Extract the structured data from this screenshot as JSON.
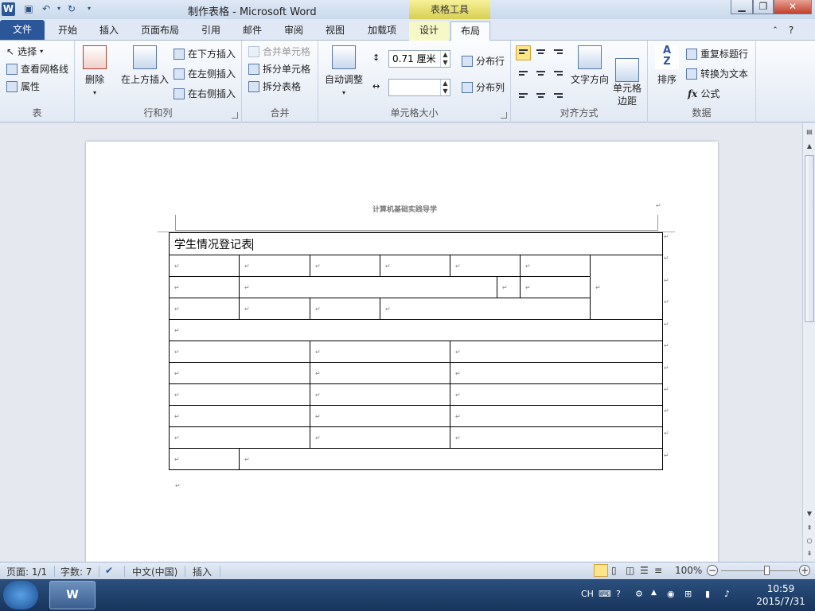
{
  "window": {
    "title": "制作表格 - Microsoft Word",
    "context_tab": "表格工具"
  },
  "tabs": [
    "文件",
    "开始",
    "插入",
    "页面布局",
    "引用",
    "邮件",
    "审阅",
    "视图",
    "加载项",
    "设计",
    "布局"
  ],
  "ribbon": {
    "table_group": {
      "label": "表",
      "select": "选择",
      "view_gridlines": "查看网格线",
      "properties": "属性"
    },
    "rows_cols_group": {
      "label": "行和列",
      "delete": "删除",
      "insert_above": "在上方插入",
      "insert_below": "在下方插入",
      "insert_left": "在左侧插入",
      "insert_right": "在右侧插入"
    },
    "merge_group": {
      "label": "合并",
      "merge_cells": "合并单元格",
      "split_cells": "拆分单元格",
      "split_table": "拆分表格"
    },
    "cell_size_group": {
      "label": "单元格大小",
      "autofit": "自动调整",
      "height_value": "0.71 厘米",
      "width_value": "",
      "distribute_rows": "分布行",
      "distribute_cols": "分布列"
    },
    "alignment_group": {
      "label": "对齐方式",
      "text_direction": "文字方向",
      "cell_margins": "单元格\n边距"
    },
    "data_group": {
      "label": "数据",
      "sort": "排序",
      "repeat_header": "重复标题行",
      "convert_to_text": "转换为文本",
      "formula": "公式"
    }
  },
  "document": {
    "header_text": "计算机基础实践导学",
    "table_title": "学生情况登记表",
    "paragraph_mark": "↵"
  },
  "status": {
    "page": "页面: 1/1",
    "words": "字数: 7",
    "language": "中文(中国)",
    "mode": "插入",
    "zoom": "100%",
    "zoom_percent": 100
  },
  "taskbar": {
    "ime": "CH",
    "time": "10:59",
    "date": "2015/7/31"
  },
  "colors": {
    "file_tab": "#2b579a",
    "context_tab": "#e2d95a",
    "taskbar": "#1f416b"
  }
}
